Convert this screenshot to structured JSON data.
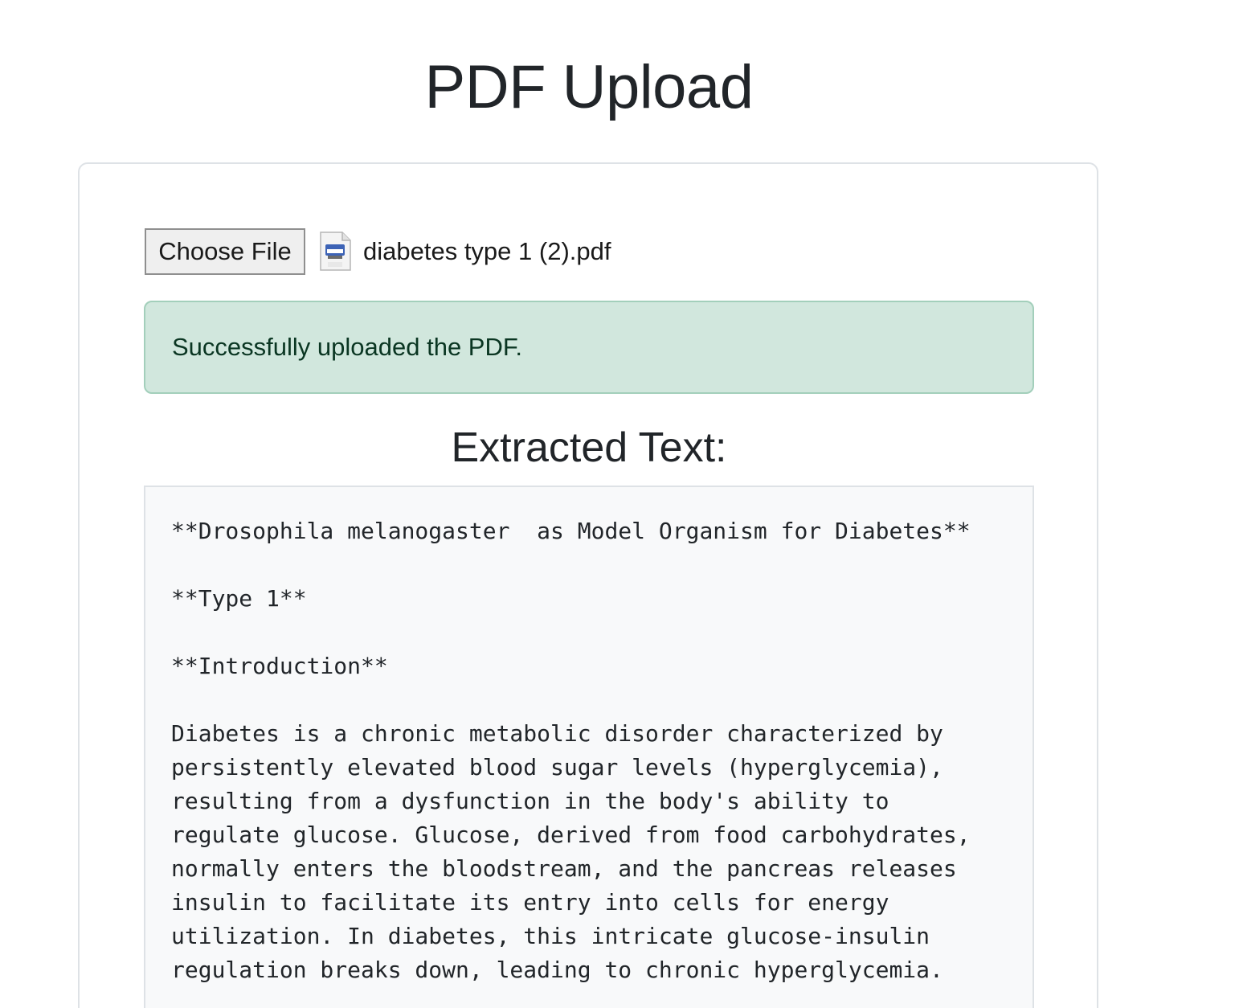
{
  "page": {
    "title": "PDF Upload"
  },
  "upload": {
    "choose_file_label": "Choose File",
    "file_icon": "pdf-file-icon",
    "file_name": "diabetes type 1 (2).pdf"
  },
  "alert": {
    "message": "Successfully uploaded the PDF.",
    "colors": {
      "background": "#d1e7dd",
      "border": "#a3cfbb",
      "text": "#0a3622"
    }
  },
  "extracted": {
    "heading": "Extracted Text:",
    "content": "**Drosophila melanogaster  as Model Organism for Diabetes**\n\n**Type 1**\n\n**Introduction**\n\nDiabetes is a chronic metabolic disorder characterized by\npersistently elevated blood sugar levels (hyperglycemia),\nresulting from a dysfunction in the body's ability to\nregulate glucose. Glucose, derived from food carbohydrates,\nnormally enters the bloodstream, and the pancreas releases\ninsulin to facilitate its entry into cells for energy\nutilization. In diabetes, this intricate glucose-insulin\nregulation breaks down, leading to chronic hyperglycemia."
  }
}
